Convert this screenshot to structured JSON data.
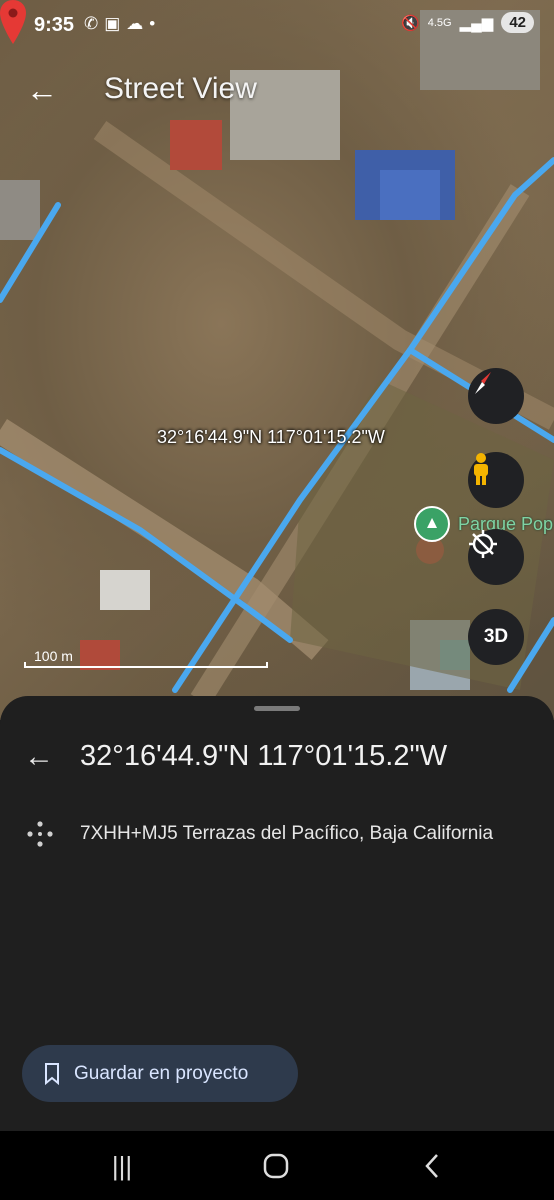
{
  "status": {
    "time": "9:35",
    "battery": "42",
    "network": "4.5G"
  },
  "header": {
    "title": "Street View"
  },
  "map": {
    "coordinate_label": "32°16'44.9\"N 117°01'15.2\"W",
    "place_label": "Parque Pop",
    "scale_label": "100 m",
    "three_d_label": "3D",
    "colors": {
      "street_view_line": "#4aa8ef",
      "pin": "#e53935",
      "park": "#3aa266"
    }
  },
  "sheet": {
    "title": "32°16'44.9\"N 117°01'15.2\"W",
    "plus_code": "7XHH+MJ5 Terrazas del Pacífico, Baja California",
    "save_button": "Guardar en proyecto"
  }
}
